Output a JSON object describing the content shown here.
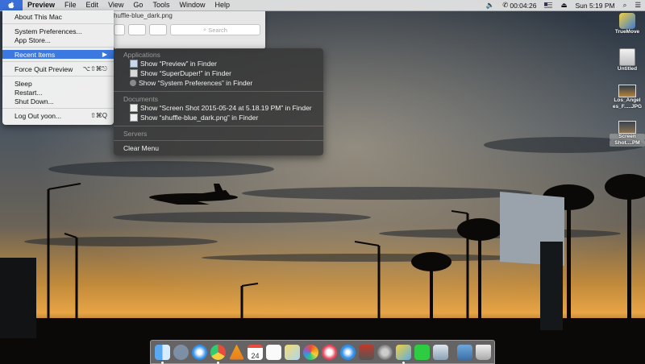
{
  "menubar": {
    "app_name": "Preview",
    "menus": [
      "File",
      "Edit",
      "View",
      "Go",
      "Tools",
      "Window",
      "Help"
    ],
    "status": {
      "timer": "00:04:26",
      "clock": "Sun 5:19 PM"
    }
  },
  "apple_menu": {
    "items": {
      "about": "About This Mac",
      "system_prefs": "System Preferences...",
      "app_store": "App Store...",
      "recent_items": "Recent Items",
      "force_quit": "Force Quit Preview",
      "force_quit_shortcut": "⌥⇧⌘⎋",
      "sleep": "Sleep",
      "restart": "Restart...",
      "shutdown": "Shut Down...",
      "logout": "Log Out yoon...",
      "logout_shortcut": "⇧⌘Q"
    }
  },
  "recent_submenu": {
    "applications_header": "Applications",
    "applications": [
      "Show “Preview” in Finder",
      "Show “SuperDuper!” in Finder",
      "Show “System Preferences” in Finder"
    ],
    "documents_header": "Documents",
    "documents": [
      "Show “Screen Shot 2015-05-24 at 5.18.19 PM” in Finder",
      "Show “shuffle-blue_dark.png” in Finder"
    ],
    "servers_header": "Servers",
    "clear_label": "Clear Menu"
  },
  "preview_window": {
    "title": "huffle-blue_dark.png",
    "search_placeholder": "Search"
  },
  "desktop_icons": {
    "truemove": "TrueMove",
    "untitled": "Untitled",
    "la_jpg_line1": "Los_Angel",
    "la_jpg_line2": "es_F.....JPG",
    "screenshot_line1": "Screen",
    "screenshot_line2": "Shot....PM"
  },
  "dock": {
    "calendar_day": "24"
  },
  "colors": {
    "highlight": "#3b78e0",
    "menubar": "#e8e8e8"
  }
}
